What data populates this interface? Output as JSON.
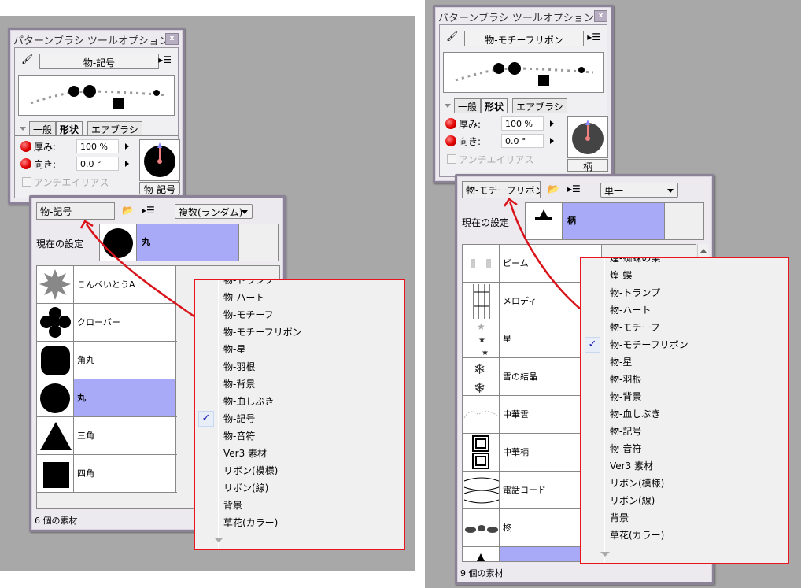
{
  "left": {
    "tool_window": {
      "title": "パターンブラシ ツールオプション",
      "close": "x",
      "brush_name": "物-記号",
      "tabs": [
        "一般",
        "形状",
        "エアブラシ"
      ],
      "active_tab": "形状",
      "thickness_label": "厚み:",
      "thickness_value": "100 %",
      "direction_label": "向き:",
      "direction_value": "0.0 °",
      "antialias_label": "アンチエイリアス",
      "shape_label": "物-記号"
    },
    "material_window": {
      "name_field": "物-記号",
      "mode_dropdown": "複数(ランダム)",
      "current_label": "現在の設定",
      "current_name": "丸",
      "items": [
        {
          "name": "こんぺいとうA",
          "shape": "star"
        },
        {
          "name": "クローバー",
          "shape": "clover"
        },
        {
          "name": "角丸",
          "shape": "rounded-square"
        },
        {
          "name": "丸",
          "shape": "circle",
          "selected": true
        },
        {
          "name": "三角",
          "shape": "triangle"
        },
        {
          "name": "四角",
          "shape": "square"
        }
      ],
      "status": "6 個の素材"
    },
    "menu": {
      "items": [
        "物-トランプ",
        "物-ハート",
        "物-モチーフ",
        "物-モチーフリボン",
        "物-星",
        "物-羽根",
        "物-背景",
        "物-血しぶき",
        "物-記号",
        "物-音符",
        "Ver3 素材",
        "リボン(模様)",
        "リボン(線)",
        "背景",
        "草花(カラー)"
      ],
      "checked": "物-記号"
    }
  },
  "right": {
    "tool_window": {
      "title": "パターンブラシ ツールオプション",
      "close": "x",
      "brush_name": "物-モチーフリボン",
      "tabs": [
        "一般",
        "形状",
        "エアブラシ"
      ],
      "active_tab": "形状",
      "thickness_label": "厚み:",
      "thickness_value": "100 %",
      "direction_label": "向き:",
      "direction_value": "0.0 °",
      "antialias_label": "アンチエイリアス",
      "shape_label": "柄"
    },
    "material_window": {
      "name_field": "物-モチーフリボン",
      "mode_dropdown": "単一",
      "current_label": "現在の設定",
      "current_name": "柄",
      "items": [
        {
          "name": "ビーム",
          "shape": "beam"
        },
        {
          "name": "メロディ",
          "shape": "melody"
        },
        {
          "name": "星",
          "shape": "stars"
        },
        {
          "name": "雪の結晶",
          "shape": "snow"
        },
        {
          "name": "中華雲",
          "shape": "cloud"
        },
        {
          "name": "中華柄",
          "shape": "spiral"
        },
        {
          "name": "電話コード",
          "shape": "cord"
        },
        {
          "name": "柊",
          "shape": "holly"
        },
        {
          "name": "",
          "shape": "pattern",
          "selected": true
        }
      ],
      "status": "9 個の素材"
    },
    "menu": {
      "items": [
        "煌-蜘蛛の巣",
        "煌-蝶",
        "物-トランプ",
        "物-ハート",
        "物-モチーフ",
        "物-モチーフリボン",
        "物-星",
        "物-羽根",
        "物-背景",
        "物-血しぶき",
        "物-記号",
        "物-音符",
        "Ver3 素材",
        "リボン(模様)",
        "リボン(線)",
        "背景",
        "草花(カラー)"
      ],
      "checked": "物-モチーフリボン"
    }
  },
  "colors": {
    "selection": "#a8aaf8",
    "annotation": "#e8141e",
    "background": "#a8a8a8"
  }
}
